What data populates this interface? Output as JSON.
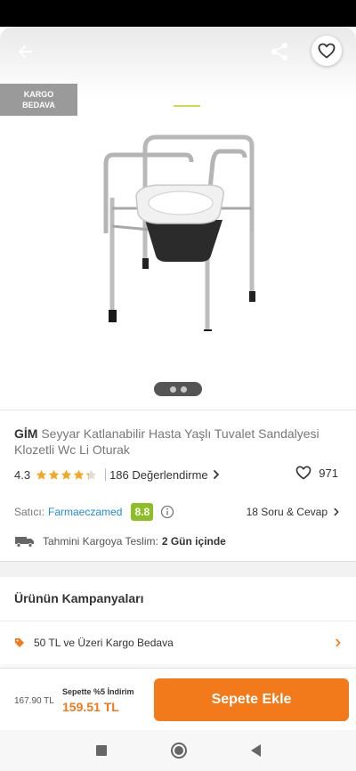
{
  "badge": {
    "line1": "KARGO",
    "line2": "BEDAVA"
  },
  "product": {
    "brand": "GİM",
    "name": " Seyyar Katlanabilir Hasta Yaşlı Tuvalet Sandalyesi Klozetli Wc Li Oturak"
  },
  "rating": {
    "value": "4.3",
    "stars": 4.3,
    "reviews": "186 Değerlendirme",
    "likes": "971"
  },
  "seller": {
    "label": "Satıcı:",
    "name": "Farmaeczamed",
    "score": "8.8",
    "qa": "18 Soru & Cevap"
  },
  "delivery": {
    "label": "Tahmini Kargoya Teslim:",
    "value": "2 Gün içinde"
  },
  "campaigns": {
    "title": "Ürünün Kampanyaları",
    "items": [
      "50 TL ve Üzeri Kargo Bedava"
    ]
  },
  "price": {
    "old": "167.90 TL",
    "discount_label": "Sepette %5 İndirim",
    "new": "159.51 TL"
  },
  "cart_button": "Sepete Ekle",
  "colors": {
    "accent": "#f27a1a",
    "link": "#1d8be0",
    "score": "#8cbf26",
    "star": "#f5a623"
  },
  "icons": [
    "back-arrow-icon",
    "share-icon",
    "heart-icon",
    "star-icon",
    "chevron-right-icon",
    "info-icon",
    "truck-icon",
    "tag-icon"
  ]
}
